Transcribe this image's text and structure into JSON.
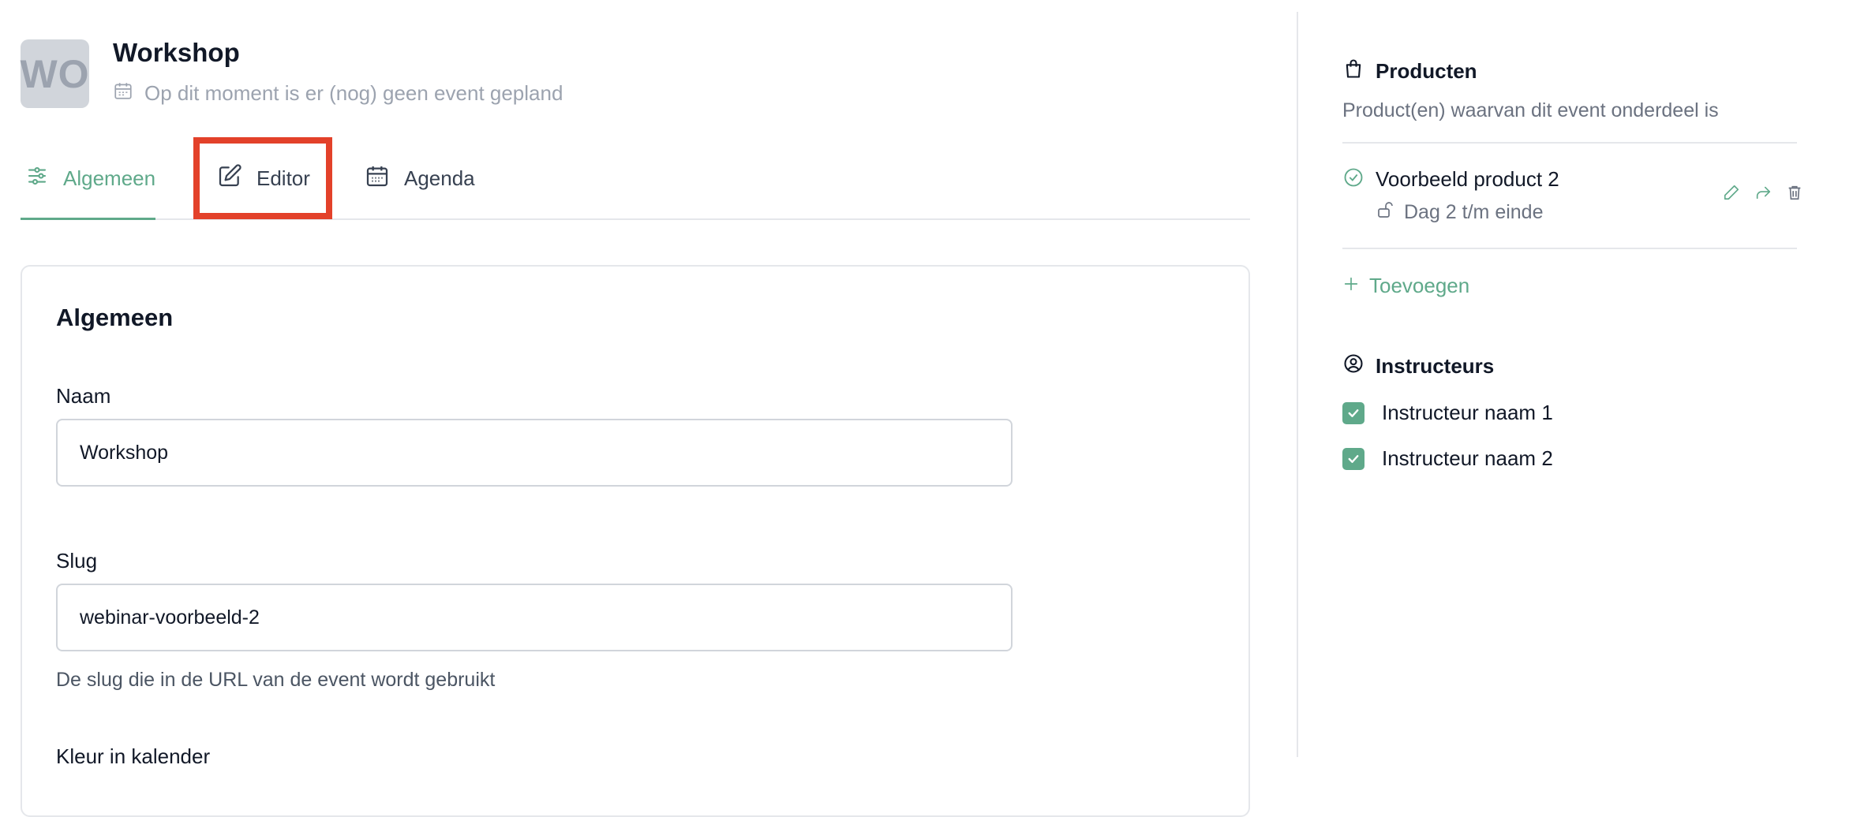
{
  "header": {
    "avatar_initials": "WO",
    "title": "Workshop",
    "subtitle": "Op dit moment is er (nog) geen event gepland"
  },
  "tabs": [
    {
      "label": "Algemeen",
      "active": true,
      "icon": "sliders-icon"
    },
    {
      "label": "Editor",
      "active": false,
      "icon": "edit-icon"
    },
    {
      "label": "Agenda",
      "active": false,
      "icon": "calendar-icon"
    }
  ],
  "card": {
    "title": "Algemeen",
    "fields": {
      "naam": {
        "label": "Naam",
        "value": "Workshop"
      },
      "slug": {
        "label": "Slug",
        "value": "webinar-voorbeeld-2",
        "helper": "De slug die in de URL van de event wordt gebruikt"
      },
      "kleur": {
        "label": "Kleur in kalender"
      }
    }
  },
  "sidebar": {
    "producten": {
      "title": "Producten",
      "description": "Product(en) waarvan dit event onderdeel is",
      "items": [
        {
          "name": "Voorbeeld product 2",
          "access": "Dag 2 t/m einde"
        }
      ],
      "add_label": "Toevoegen"
    },
    "instructeurs": {
      "title": "Instructeurs",
      "items": [
        {
          "name": "Instructeur naam 1",
          "checked": true
        },
        {
          "name": "Instructeur naam 2",
          "checked": true
        }
      ]
    }
  },
  "colors": {
    "accent": "#5fa98a",
    "highlight": "#e3412a"
  }
}
